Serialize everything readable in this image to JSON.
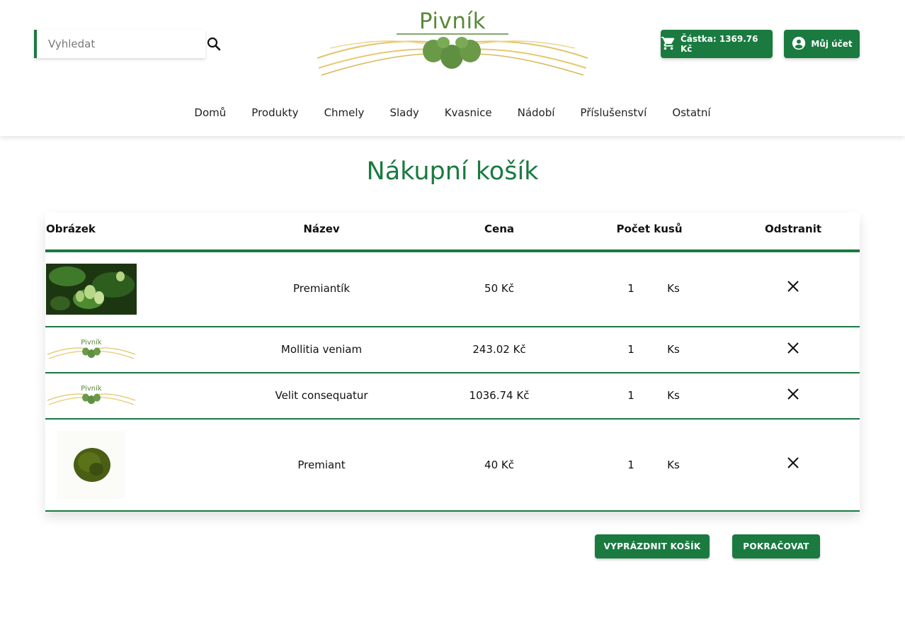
{
  "search": {
    "placeholder": "Vyhledat"
  },
  "logo": {
    "text": "Pivník"
  },
  "header": {
    "cart_label": "Částka: 1369.76 Kč",
    "account_label": "Můj účet"
  },
  "nav": {
    "items": [
      "Domů",
      "Produkty",
      "Chmely",
      "Slady",
      "Kvasnice",
      "Nádobí",
      "Příslušenství",
      "Ostatní"
    ]
  },
  "page": {
    "title": "Nákupní košík"
  },
  "table": {
    "headers": [
      "Obrázek",
      "Název",
      "Cena",
      "Počet kusů",
      "Odstranit"
    ],
    "rows": [
      {
        "image": "hop-plant-photo",
        "name": "Premiantík",
        "price": "50 Kč",
        "qty": "1",
        "unit": "Ks"
      },
      {
        "image": "pivnik-logo-thumbnail",
        "name": "Mollitia veniam",
        "price": "243.02 Kč",
        "qty": "1",
        "unit": "Ks"
      },
      {
        "image": "pivnik-logo-thumbnail",
        "name": "Velit consequatur",
        "price": "1036.74 Kč",
        "qty": "1",
        "unit": "Ks"
      },
      {
        "image": "hop-pellets-photo",
        "name": "Premiant",
        "price": "40 Kč",
        "qty": "1",
        "unit": "Ks"
      }
    ]
  },
  "actions": {
    "empty_label": "VYPRÁZDNIT KOŠÍK",
    "continue_label": "POKRAČOVAT"
  },
  "colors": {
    "brand_green": "#1a7a40",
    "logo_green": "#5a8a3a",
    "wheat": "#e3c46a"
  },
  "icons": {
    "search": "search-icon",
    "cart": "cart-icon",
    "account": "account-circle-icon",
    "remove": "close-icon"
  }
}
